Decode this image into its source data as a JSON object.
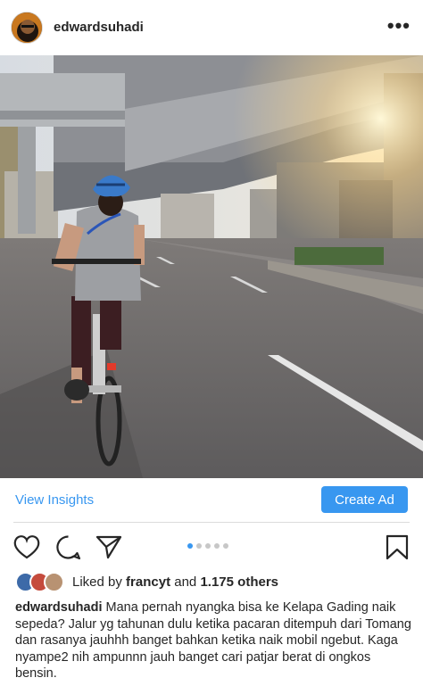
{
  "post": {
    "username": "edwardsuhadi",
    "more_icon": "more-horizontal-icon"
  },
  "insights": {
    "view_label": "View Insights",
    "create_ad_label": "Create Ad"
  },
  "actions": {
    "icons": [
      "heart-icon",
      "comment-icon",
      "share-icon",
      "bookmark-icon"
    ],
    "carousel_total": 5,
    "carousel_active": 1
  },
  "likes": {
    "prefix": "Liked by",
    "user": "francyt",
    "and": "and",
    "others": "1.175 others"
  },
  "caption": {
    "username": "edwardsuhadi",
    "text": "Mana pernah nyangka bisa ke Kelapa Gading naik sepeda? Jalur yg tahunan dulu ketika pacaran ditempuh dari Tomang dan rasanya jauhhh banget bahkan ketika naik mobil ngebut. Kaga nyampe2 nih ampunnn jauh banget cari patjar berat di ongkos bensin."
  },
  "colors": {
    "accent": "#3897f0",
    "text": "#262626",
    "divider": "#dbdbdb"
  }
}
